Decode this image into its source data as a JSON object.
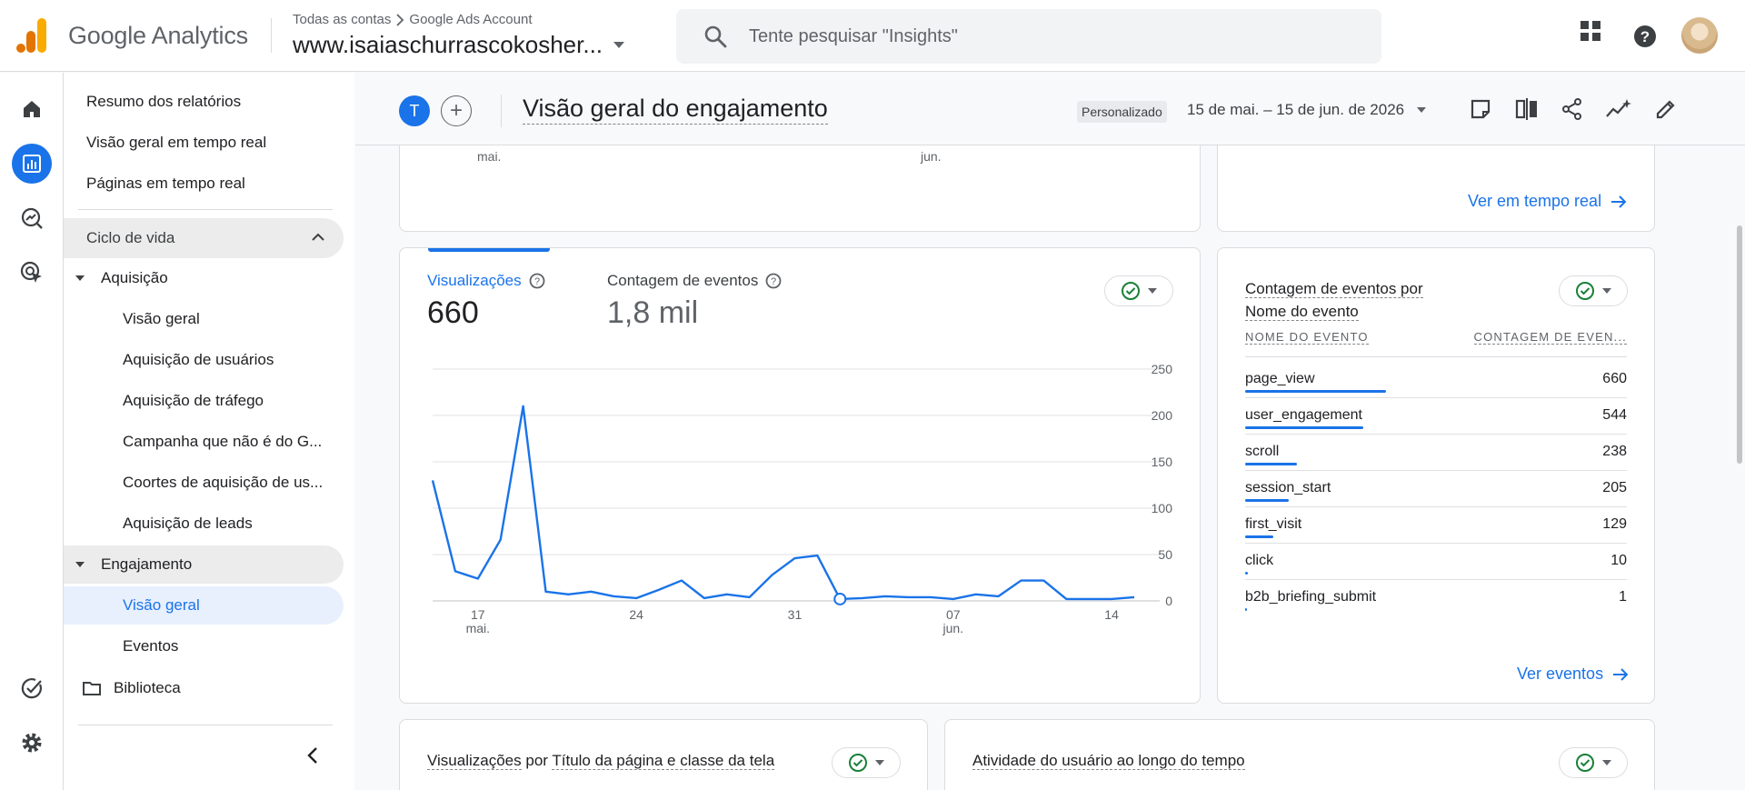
{
  "app": {
    "brand": "Google Analytics"
  },
  "account": {
    "breadcrumb_root": "Todas as contas",
    "breadcrumb_account": "Google Ads Account",
    "property": "www.isaiaschurrascokosher..."
  },
  "search": {
    "placeholder": "Tente pesquisar \"Insights\""
  },
  "nav": {
    "items": [
      "Resumo dos relatórios",
      "Visão geral em tempo real",
      "Páginas em tempo real"
    ],
    "lifecycle": "Ciclo de vida",
    "acquisition": {
      "label": "Aquisição",
      "children": [
        "Visão geral",
        "Aquisição de usuários",
        "Aquisição de tráfego",
        "Campanha que não é do G...",
        "Coortes de aquisição de us...",
        "Aquisição de leads"
      ]
    },
    "engagement": {
      "label": "Engajamento",
      "children": [
        "Visão geral",
        "Eventos"
      ]
    },
    "library": "Biblioteca"
  },
  "header": {
    "avatar_letter": "T",
    "add_symbol": "+",
    "title": "Visão geral do engajamento",
    "badge": "Personalizado",
    "date_range": "15 de mai. – 15 de jun. de 2026"
  },
  "top_card": {
    "x_labels": [
      {
        "text": "mai.",
        "pos": "left"
      },
      {
        "text": "jun.",
        "pos": "mid"
      }
    ]
  },
  "realtime_card": {
    "link": "Ver em tempo real"
  },
  "main_chart_card": {
    "metric1_label": "Visualizações",
    "metric1_value": "660",
    "metric2_label": "Contagem de eventos",
    "metric2_value": "1,8 mil"
  },
  "chart_data": {
    "type": "line",
    "x": [
      "15/05",
      "16/05",
      "17/05",
      "18/05",
      "19/05",
      "20/05",
      "21/05",
      "22/05",
      "23/05",
      "24/05",
      "25/05",
      "26/05",
      "27/05",
      "28/05",
      "29/05",
      "30/05",
      "31/05",
      "01/06",
      "02/06",
      "03/06",
      "04/06",
      "05/06",
      "06/06",
      "07/06",
      "08/06",
      "09/06",
      "10/06",
      "11/06",
      "12/06",
      "13/06",
      "14/06",
      "15/06"
    ],
    "series": [
      {
        "values": [
          130,
          32,
          24,
          66,
          210,
          10,
          7,
          10,
          5,
          3,
          12,
          22,
          3,
          7,
          4,
          28,
          46,
          49,
          2,
          3,
          5,
          4,
          4,
          2,
          7,
          5,
          22,
          22,
          2,
          2,
          2,
          4
        ]
      }
    ],
    "x_ticks": [
      {
        "label": "17",
        "sub": "mai.",
        "index": 2
      },
      {
        "label": "24",
        "sub": "",
        "index": 9
      },
      {
        "label": "31",
        "sub": "",
        "index": 16
      },
      {
        "label": "07",
        "sub": "jun.",
        "index": 23
      },
      {
        "label": "14",
        "sub": "",
        "index": 30
      }
    ],
    "y_ticks": [
      "250",
      "200",
      "150",
      "100",
      "50",
      "0"
    ],
    "ylim": [
      0,
      250
    ],
    "grid": true,
    "highlight_index": 18,
    "color": "#1a73e8"
  },
  "events_card": {
    "title_line1": "Contagem de eventos por",
    "title_line2": "Nome do evento",
    "col1": "NOME DO EVENTO",
    "col2": "CONTAGEM DE EVEN...",
    "rows": [
      {
        "name": "page_view",
        "value": "660",
        "fraction": 0.37
      },
      {
        "name": "user_engagement",
        "value": "544",
        "fraction": 0.31
      },
      {
        "name": "scroll",
        "value": "238",
        "fraction": 0.135
      },
      {
        "name": "session_start",
        "value": "205",
        "fraction": 0.115
      },
      {
        "name": "first_visit",
        "value": "129",
        "fraction": 0.073
      },
      {
        "name": "click",
        "value": "10",
        "fraction": 0.006
      },
      {
        "name": "b2b_briefing_submit",
        "value": "1",
        "fraction": 0.001
      }
    ],
    "link": "Ver eventos"
  },
  "bottom_cards": {
    "left_title_part1": "Visualizações",
    "left_title_part2": "por",
    "left_title_part3": "Título da página e classe da tela",
    "right_title": "Atividade do usuário ao longo do tempo"
  },
  "colors": {
    "accent": "#1a73e8",
    "success": "#188038"
  }
}
